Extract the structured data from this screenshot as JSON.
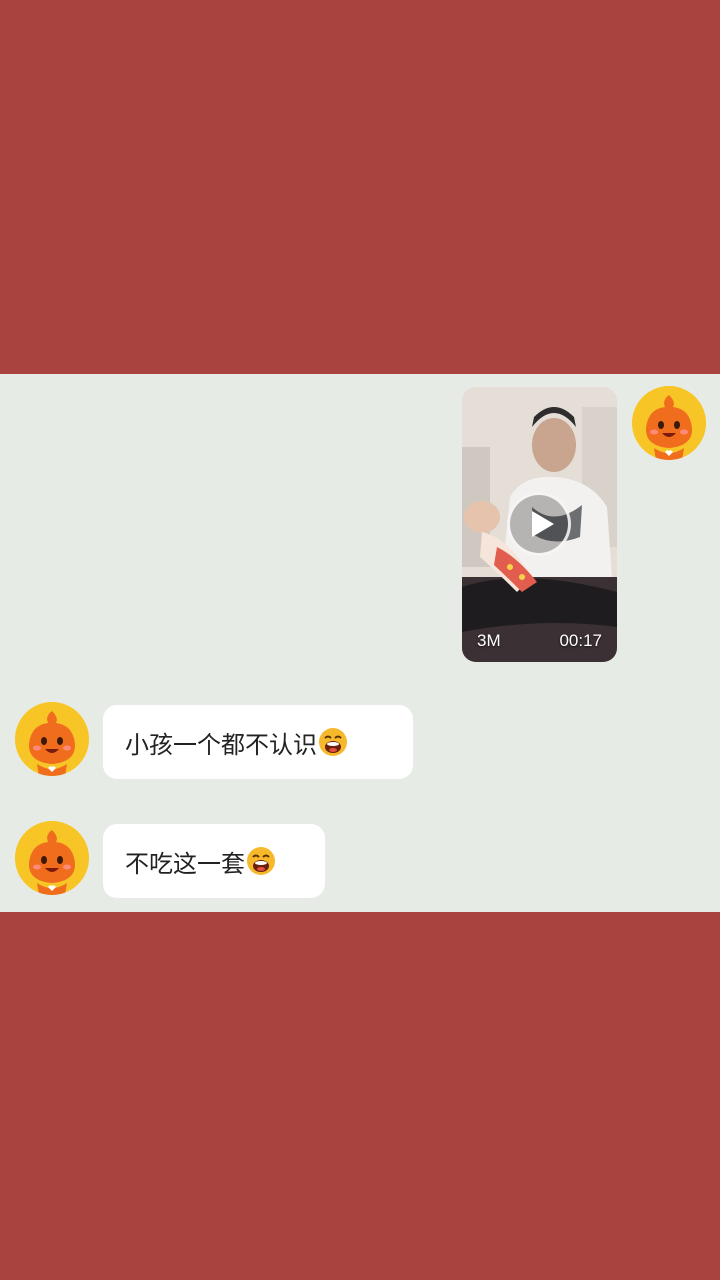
{
  "colors": {
    "frame_background": "#a8433f",
    "chat_background": "#e7ebe5",
    "bubble_background": "#ffffff",
    "avatar_background": "#f7c626"
  },
  "messages": [
    {
      "sender": "self",
      "type": "video",
      "size": "3M",
      "duration": "00:17",
      "avatar_icon": "orange-mascot-icon",
      "play_icon": "play-icon"
    },
    {
      "sender": "other",
      "type": "text",
      "text": "小孩一个都不认识",
      "emoji_icon": "laughing-crying-emoji-icon",
      "avatar_icon": "orange-mascot-icon"
    },
    {
      "sender": "other",
      "type": "text",
      "text": "不吃这一套",
      "emoji_icon": "laughing-crying-emoji-icon",
      "avatar_icon": "orange-mascot-icon"
    }
  ]
}
